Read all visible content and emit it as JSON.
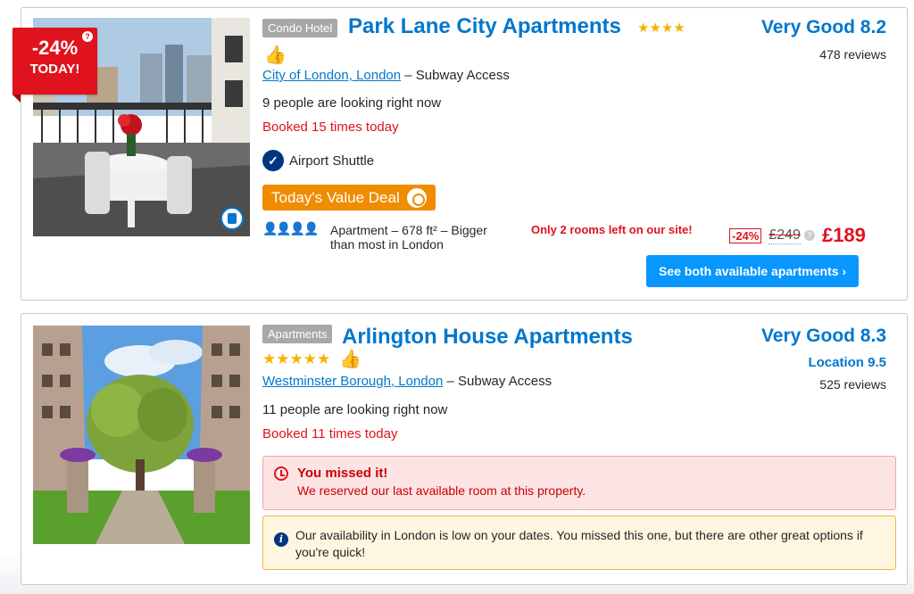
{
  "listings": [
    {
      "badge": {
        "discount": "-24%",
        "label": "TODAY!",
        "help": "?"
      },
      "type": "Condo Hotel",
      "name": "Park Lane City Apartments",
      "stars": "★★★★",
      "location_link": "City of London, London",
      "location_suffix": " – Subway Access",
      "looking": "9 people are looking right now",
      "booked": "Booked 15 times today",
      "shuttle": "Airport Shuttle",
      "deal": "Today's Value Deal",
      "occupancy": "👤👤👤👤",
      "room": "Apartment – 678 ft² – Bigger than most in London",
      "rooms_left": "Only 2 rooms left on our site!",
      "price": {
        "discount": "-24%",
        "old": "£249",
        "help": "?",
        "new": "£189"
      },
      "cta": "See both available apartments ›",
      "score": "Very Good 8.2",
      "reviews": "478 reviews"
    },
    {
      "type": "Apartments",
      "name": "Arlington House Apartments",
      "stars": "★★★★★",
      "location_link": "Westminster Borough, London",
      "location_suffix": " – Subway Access",
      "looking": "11 people are looking right now",
      "booked": "Booked 11 times today",
      "missed_title": "You missed it!",
      "missed_text": "We reserved our last available room at this property.",
      "notice": "Our availability in London is low on your dates. You missed this one, but there are other great options if you're quick!",
      "score": "Very Good 8.3",
      "location_score": "Location 9.5",
      "reviews": "525 reviews"
    }
  ],
  "colors": {
    "link": "#0077cc",
    "alert": "#e0121d",
    "deal": "#f08c00",
    "cta": "#0896ff",
    "brand": "#003580"
  }
}
